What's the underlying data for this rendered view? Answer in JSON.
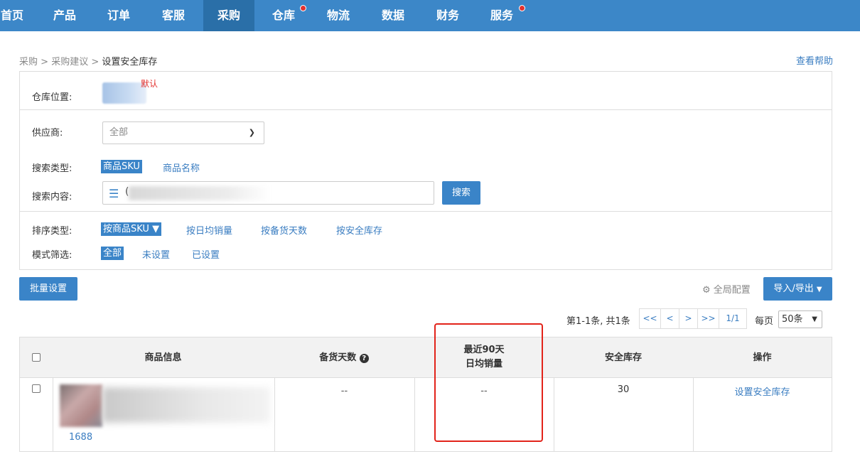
{
  "nav": {
    "items": [
      {
        "label": "首页",
        "badge": false
      },
      {
        "label": "产品",
        "badge": false
      },
      {
        "label": "订单",
        "badge": false
      },
      {
        "label": "客服",
        "badge": false
      },
      {
        "label": "采购",
        "badge": false,
        "active": true
      },
      {
        "label": "仓库",
        "badge": true
      },
      {
        "label": "物流",
        "badge": false
      },
      {
        "label": "数据",
        "badge": false
      },
      {
        "label": "财务",
        "badge": false
      },
      {
        "label": "服务",
        "badge": true
      }
    ]
  },
  "breadcrumb": {
    "items": [
      "采购",
      "采购建议"
    ],
    "separator": ">",
    "current": "设置安全库存"
  },
  "help_link": "查看帮助",
  "filters": {
    "warehouse_label": "仓库位置:",
    "warehouse_default": "默认",
    "supplier_label": "供应商:",
    "supplier_value": "全部",
    "search_type_label": "搜索类型:",
    "search_type_options": [
      "商品SKU",
      "商品名称"
    ],
    "search_content_label": "搜索内容:",
    "search_prefix": "(",
    "search_button": "搜索",
    "sort_label": "排序类型:",
    "sort_options": [
      "按商品SKU ▼",
      "按日均销量",
      "按备货天数",
      "按安全库存"
    ],
    "mode_label": "模式筛选:",
    "mode_options": [
      "全部",
      "未设置",
      "已设置"
    ]
  },
  "toolbar": {
    "batch_button": "批量设置",
    "global_config": "全局配置",
    "import_export": "导入/导出"
  },
  "pagination": {
    "info": "第1-1条, 共1条",
    "buttons": [
      "<<",
      "<",
      ">",
      ">>"
    ],
    "page": "1/1",
    "per_page_label": "每页",
    "per_page_value": "50条"
  },
  "table": {
    "headers": {
      "product": "商品信息",
      "stock_days": "备货天数",
      "recent_90_line1": "最近90天",
      "recent_90_line2": "日均销量",
      "safety_stock": "安全库存",
      "action": "操作"
    },
    "rows": [
      {
        "source": "1688",
        "stock_days": "--",
        "daily_sales": "--",
        "safety_stock": "30",
        "action": "设置安全库存"
      }
    ]
  }
}
